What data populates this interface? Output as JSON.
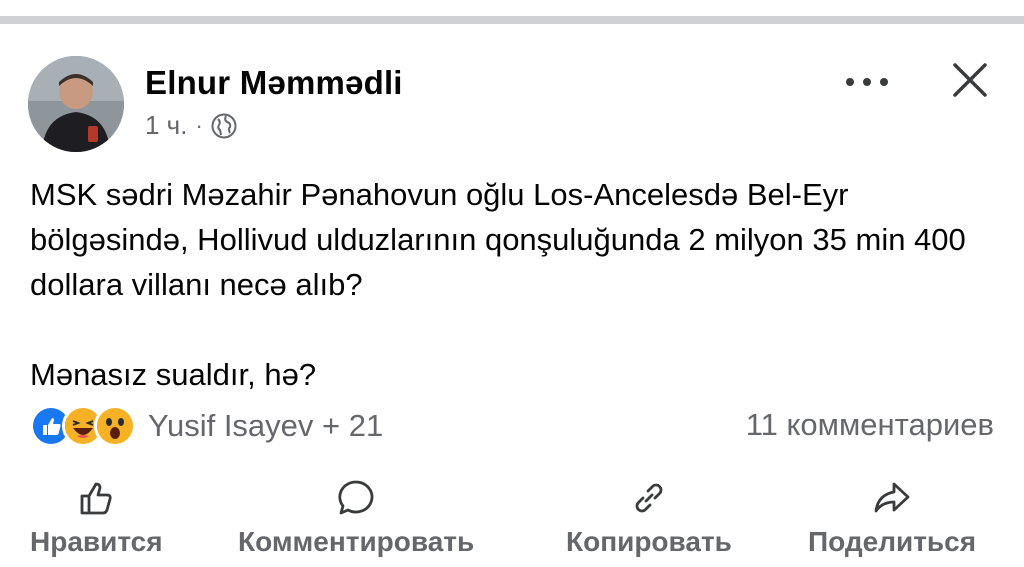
{
  "post": {
    "author": "Elnur Məmmədli",
    "time": "1 ч.",
    "separator": "·",
    "privacy_icon": "globe-icon",
    "text_paragraph_1": "MSK sədri Məzahir Pənahovun oğlu Los-Ancelesdə Bel-Eyr bölgəsində, Hollivud ulduzlarının qonşuluğunda 2 milyon 35 min 400 dollara villanı necə alıb?",
    "text_paragraph_2": "Mənasız sualdır, hə?"
  },
  "header_icons": {
    "more": "more-options-icon",
    "close": "close-icon"
  },
  "reactions": {
    "icons": [
      "like-reaction-icon",
      "haha-reaction-icon",
      "wow-reaction-icon"
    ],
    "names": "Yusif Isayev + 21",
    "comments": "11 комментариев"
  },
  "actions": {
    "like": "Нравится",
    "comment": "Комментировать",
    "copy": "Копировать",
    "share": "Поделиться"
  },
  "colors": {
    "like_blue": "#1877f2",
    "emoji_yellow": "#f7b125",
    "secondary_text": "#65676b"
  }
}
